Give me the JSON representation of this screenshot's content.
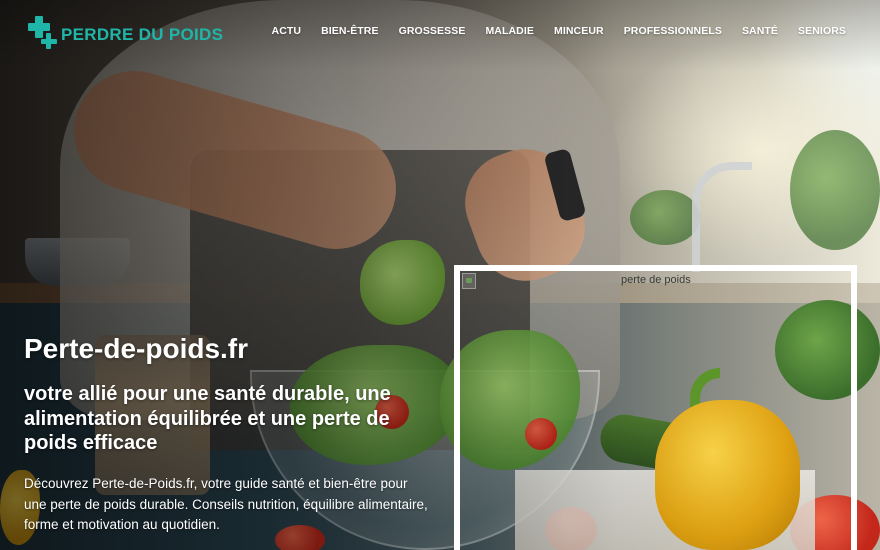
{
  "header": {
    "logo_text": "PERDRE DU POIDS",
    "nav": [
      {
        "label": "ACTU"
      },
      {
        "label": "BIEN-ÊTRE"
      },
      {
        "label": "GROSSESSE"
      },
      {
        "label": "MALADIE"
      },
      {
        "label": "MINCEUR"
      },
      {
        "label": "PROFESSIONNELS"
      },
      {
        "label": "SANTÉ"
      },
      {
        "label": "SENIORS"
      }
    ]
  },
  "hero": {
    "title": "Perte-de-poids.fr",
    "subtitle": "votre allié pour une santé durable, une alimentation équilibrée et une perte de poids efficace",
    "description": "Découvrez Perte-de-Poids.fr, votre guide santé et bien-être pour une perte de poids durable. Conseils nutrition, équilibre alimentaire, forme et motivation au quotidien.",
    "image_alt": "perte de poids"
  },
  "colors": {
    "brand": "#1fb5a8",
    "text_on_hero": "#ffffff",
    "frame": "#ffffff"
  },
  "icons": {
    "logo": "medical-cross-icon",
    "broken_image": "broken-image-icon"
  }
}
